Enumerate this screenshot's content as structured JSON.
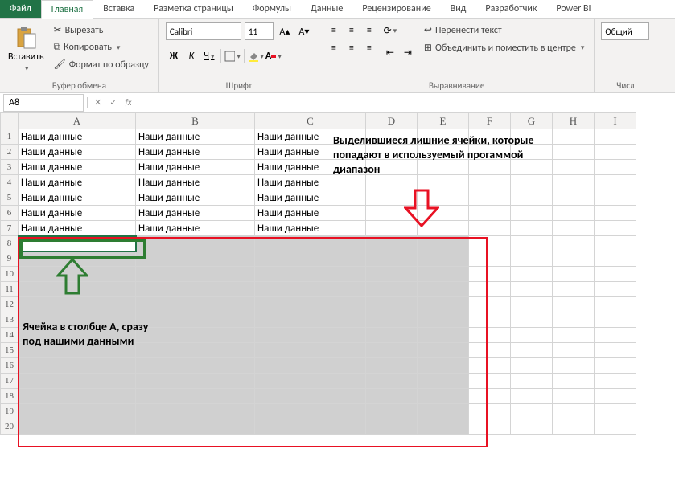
{
  "tabs": {
    "file": "Файл",
    "home": "Главная",
    "insert": "Вставка",
    "layout": "Разметка страницы",
    "formulas": "Формулы",
    "data": "Данные",
    "review": "Рецензирование",
    "view": "Вид",
    "developer": "Разработчик",
    "powerbi": "Power BI"
  },
  "ribbon": {
    "paste": "Вставить",
    "cut": "Вырезать",
    "copy": "Копировать",
    "format_painter": "Формат по образцу",
    "clipboard_group": "Буфер обмена",
    "font_group": "Шрифт",
    "align_group": "Выравнивание",
    "number_group": "Числ",
    "font_name": "Calibri",
    "font_size": "11",
    "wrap_text": "Перенести текст",
    "merge_center": "Объединить и поместить в центре",
    "number_format": "Общий"
  },
  "formula_bar": {
    "name_box": "A8",
    "fx": "fx"
  },
  "grid": {
    "columns": [
      "A",
      "B",
      "C",
      "D",
      "E",
      "F",
      "G",
      "H",
      "I"
    ],
    "rows": [
      "1",
      "2",
      "3",
      "4",
      "5",
      "6",
      "7",
      "8",
      "9",
      "10",
      "11",
      "12",
      "13",
      "14",
      "15",
      "16",
      "17",
      "18",
      "19",
      "20"
    ],
    "data_text": "Наши данные",
    "data_rows": 7,
    "data_cols": 3,
    "active_cell": "A8"
  },
  "annotations": {
    "red_text": "Выделившиеся лишние ячейки, которые попадают в используемый прогаммой диапазон",
    "green_text": "Ячейка в столбце А, сразу под нашими данными"
  },
  "colors": {
    "excel_green": "#217346",
    "red": "#e81123",
    "anno_green": "#2e7d32"
  }
}
